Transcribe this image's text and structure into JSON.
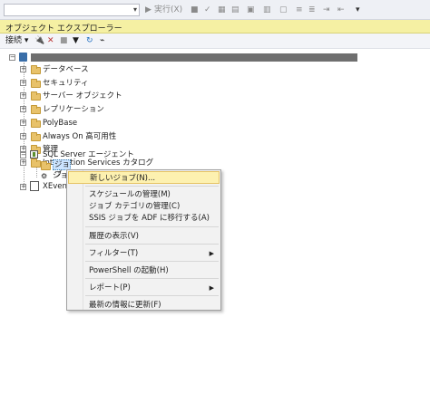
{
  "toolbar": {
    "execute_label": "実行(X)"
  },
  "object_explorer": {
    "title": "オブジェクト エクスプローラー",
    "connect_label": "接続 ▾",
    "tree": {
      "folders": [
        "データベース",
        "セキュリティ",
        "サーバー オブジェクト",
        "レプリケーション",
        "PolyBase",
        "Always On 高可用性",
        "管理",
        "Integration Services カタログ"
      ],
      "agent_label": "SQL Server エージェント",
      "agent_child_jobs": "ジョブ",
      "agent_child_second": "ジョブ",
      "xevent_label": "XEvent P"
    }
  },
  "context_menu": {
    "items": [
      {
        "label": "新しいジョブ(N)...",
        "submenu": false
      },
      {
        "label": "スケジュールの管理(M)",
        "submenu": false
      },
      {
        "label": "ジョブ カテゴリの管理(C)",
        "submenu": false
      },
      {
        "label": "SSIS ジョブを ADF に移行する(A)",
        "submenu": false
      },
      {
        "label": "履歴の表示(V)",
        "submenu": false
      },
      {
        "label": "フィルター(T)",
        "submenu": true
      },
      {
        "label": "PowerShell の起動(H)",
        "submenu": false
      },
      {
        "label": "レポート(P)",
        "submenu": true
      },
      {
        "label": "最新の情報に更新(F)",
        "submenu": false
      }
    ]
  },
  "colors": {
    "title_bar": "#f5f0a3",
    "menu_highlight": "#fdf1b0",
    "selection": "#cce4ff"
  }
}
